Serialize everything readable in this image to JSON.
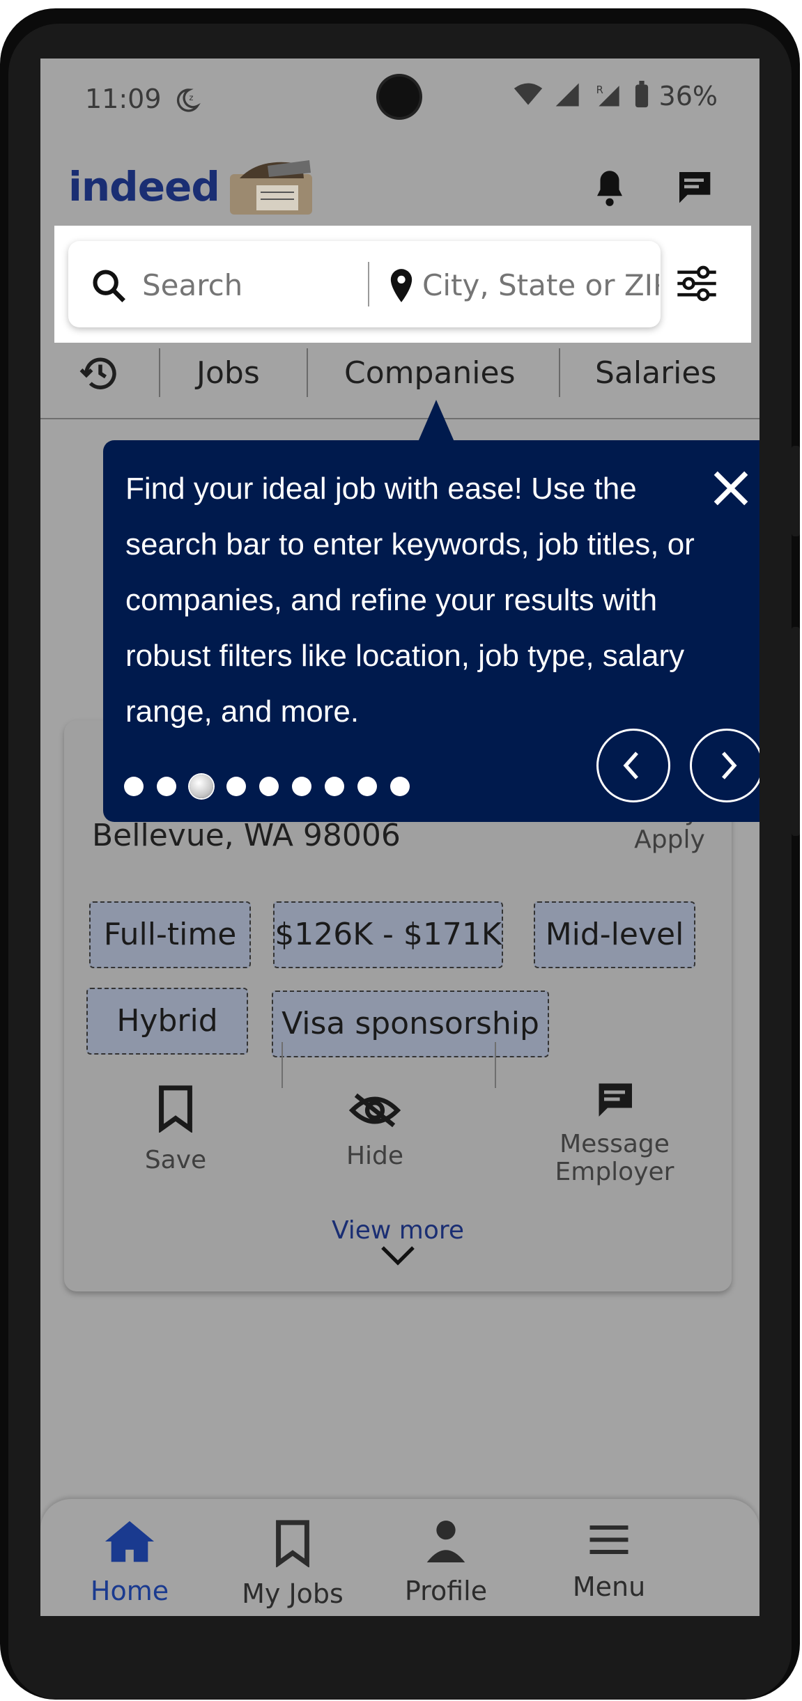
{
  "status_bar": {
    "time": "11:09",
    "battery": "36%"
  },
  "header": {
    "logo": "indeed"
  },
  "search": {
    "keyword_placeholder": "Search",
    "location_placeholder": "City, State or ZIP"
  },
  "tabs": [
    "Jobs",
    "Companies",
    "Salaries"
  ],
  "tooltip": {
    "text": "Find your ideal job with ease! Use the search bar to enter keywords, job titles, or companies, and refine your results with robust filters like location, job type, salary range, and more.",
    "dot_count": 9,
    "active_dot_index": 2
  },
  "job_card": {
    "location": "Bellevue, WA 98006",
    "easy_apply": "Easy Apply",
    "chips": [
      "Full-time",
      "$126K - $171K",
      "Mid-level",
      "Hybrid",
      "Visa sponsorship"
    ],
    "actions": {
      "save": "Save",
      "hide": "Hide",
      "message": "Message Employer"
    },
    "view_more": "View more"
  },
  "bottom_nav": [
    {
      "label": "Home",
      "icon": "home-icon",
      "active": true
    },
    {
      "label": "My Jobs",
      "icon": "bookmark-icon",
      "active": false
    },
    {
      "label": "Profile",
      "icon": "person-icon",
      "active": false
    },
    {
      "label": "Menu",
      "icon": "menu-icon",
      "active": false
    }
  ],
  "colors": {
    "brand": "#1a2e73",
    "tooltip_bg": "#001a4d",
    "overlay": "#a3a3a3"
  }
}
